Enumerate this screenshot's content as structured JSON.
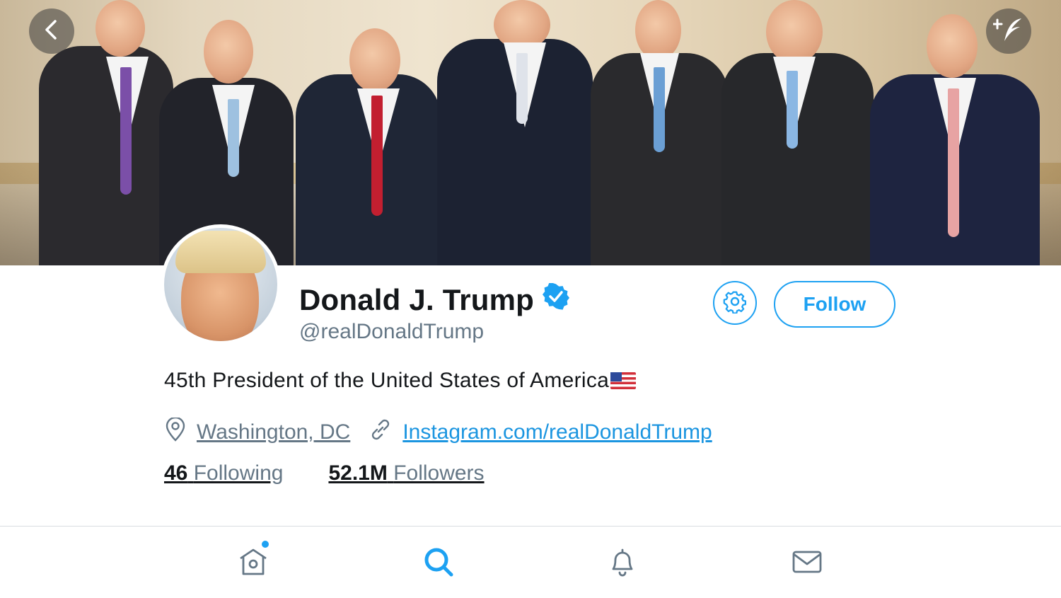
{
  "profile": {
    "name": "Donald J. Trump",
    "handle": "@realDonaldTrump",
    "verified": true,
    "bio": "45th President of the United States of America",
    "bio_emoji": "us-flag",
    "location": "Washington, DC",
    "website": "Instagram.com/realDonaldTrump",
    "following_count": "46",
    "following_label": "Following",
    "followers_count": "52.1M",
    "followers_label": "Followers"
  },
  "actions": {
    "follow_label": "Follow",
    "settings_icon": "gear-icon",
    "back_icon": "chevron-left-icon",
    "compose_icon": "compose-feather-icon"
  },
  "tabbar": {
    "items": [
      {
        "name": "home",
        "icon": "home-icon",
        "active": false,
        "has_notification_dot": true
      },
      {
        "name": "search",
        "icon": "search-icon",
        "active": true
      },
      {
        "name": "notifications",
        "icon": "bell-icon",
        "active": false
      },
      {
        "name": "messages",
        "icon": "mail-icon",
        "active": false
      }
    ]
  },
  "colors": {
    "accent": "#1da1f2",
    "link": "#1b95e0",
    "secondary_text": "#657786",
    "primary_text": "#14171a"
  }
}
